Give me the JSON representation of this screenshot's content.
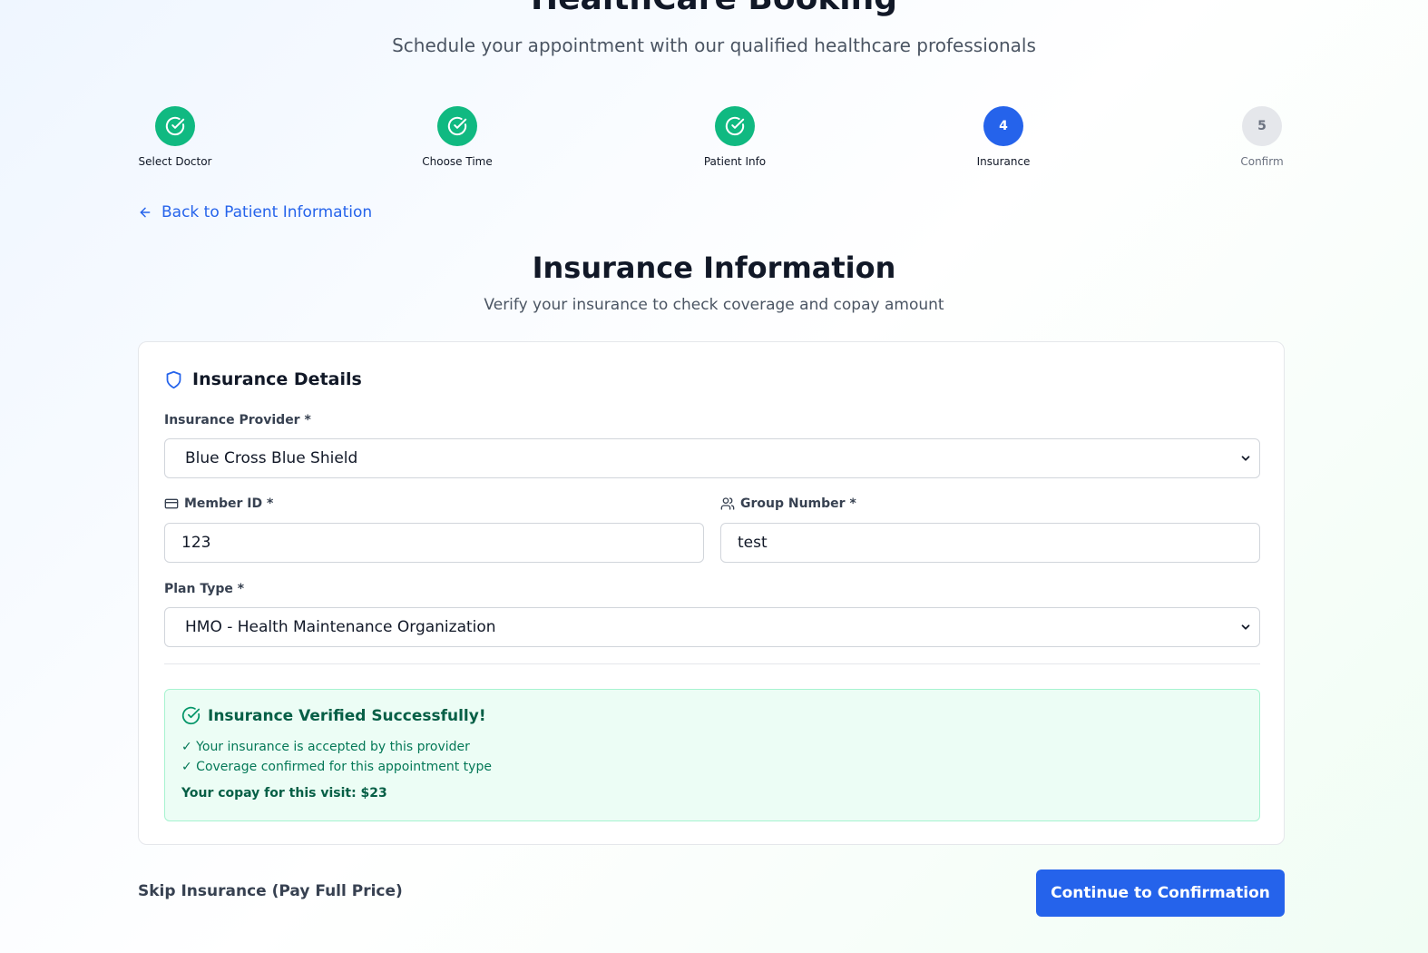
{
  "header": {
    "title": "HealthCare Booking",
    "subtitle": "Schedule your appointment with our qualified healthcare professionals"
  },
  "steps": [
    {
      "label": "Select Doctor",
      "state": "done"
    },
    {
      "label": "Choose Time",
      "state": "done"
    },
    {
      "label": "Patient Info",
      "state": "done"
    },
    {
      "label": "Insurance",
      "state": "active",
      "number": "4"
    },
    {
      "label": "Confirm",
      "state": "todo",
      "number": "5"
    }
  ],
  "back_link": "Back to Patient Information",
  "section": {
    "title": "Insurance Information",
    "subtitle": "Verify your insurance to check coverage and copay amount"
  },
  "card": {
    "title": "Insurance Details",
    "provider_label": "Insurance Provider *",
    "provider_value": "Blue Cross Blue Shield",
    "member_id_label": "Member ID *",
    "member_id_value": "123",
    "group_number_label": "Group Number *",
    "group_number_value": "test",
    "plan_type_label": "Plan Type *",
    "plan_type_value": "HMO - Health Maintenance Organization"
  },
  "verification": {
    "title": "Insurance Verified Successfully!",
    "line1": "✓ Your insurance is accepted by this provider",
    "line2": "✓ Coverage confirmed for this appointment type",
    "copay": "Your copay for this visit: $23"
  },
  "actions": {
    "skip": "Skip Insurance (Pay Full Price)",
    "continue": "Continue to Confirmation"
  },
  "colors": {
    "primary": "#2563eb",
    "success": "#10b981",
    "success_bg": "#ecfdf5"
  },
  "icons": {
    "step_done": "check-circle-icon",
    "back": "arrow-left-icon",
    "card": "shield-icon",
    "member_id": "credit-card-icon",
    "group_number": "users-icon",
    "select": "chevron-down-icon",
    "verified": "check-circle-icon"
  }
}
